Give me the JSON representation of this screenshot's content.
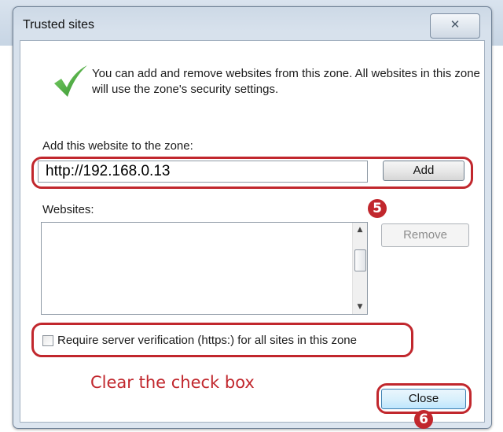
{
  "dialog": {
    "title": "Trusted sites",
    "close_glyph": "✕",
    "info_text": "You can add and remove websites from this zone. All websites in this zone will use the zone's security settings.",
    "add_label": "Add this website to the zone:",
    "url_value": "http://192.168.0.13",
    "add_button": "Add",
    "websites_label": "Websites:",
    "remove_button": "Remove",
    "require_https_label": "Require server verification (https:) for all sites in this zone",
    "require_https_checked": false,
    "close_button": "Close"
  },
  "annotations": {
    "step5": "5",
    "step6": "6",
    "instruction": "Clear the check box",
    "highlight_color": "#c1272d"
  },
  "icons": {
    "info": "green-checkmark-icon",
    "scroll_up": "scroll-up-arrow-icon",
    "scroll_down": "scroll-down-arrow-icon"
  }
}
